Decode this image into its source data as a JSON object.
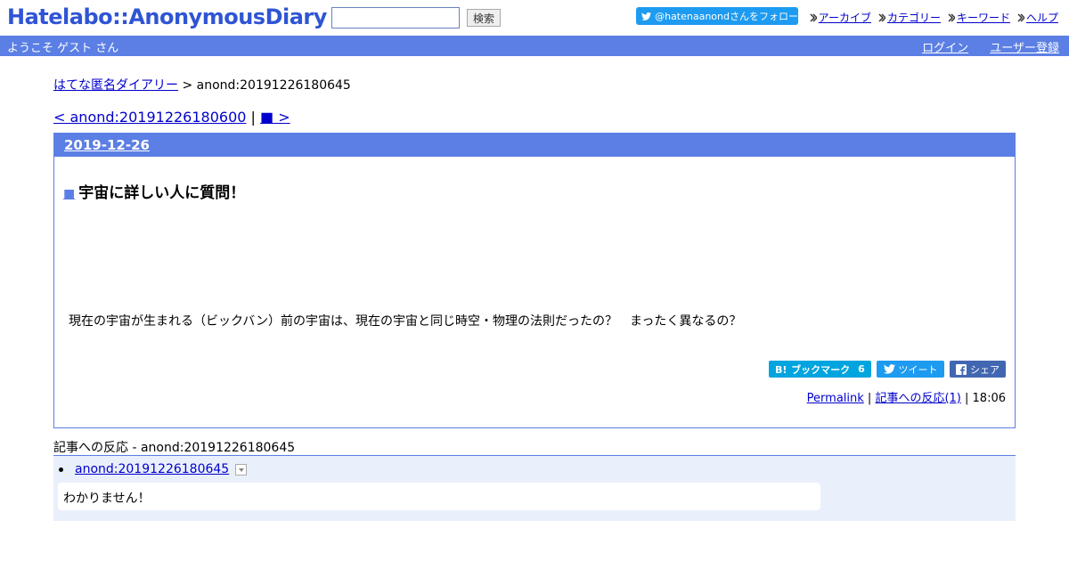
{
  "header": {
    "logo": "Hatelabo::AnonymousDiary",
    "search_placeholder": "",
    "search_button": "検索",
    "follow_button": "@hatenaanondさんをフォロー",
    "nav": [
      "アーカイブ",
      "カテゴリー",
      "キーワード",
      "ヘルプ"
    ]
  },
  "user_bar": {
    "welcome": "ようこそ ゲスト さん",
    "login": "ログイン",
    "register": "ユーザー登録"
  },
  "breadcrumb": {
    "home": "はてな匿名ダイアリー",
    "separator": " > ",
    "current": "anond:20191226180645"
  },
  "pager": {
    "prev": "< anond:20191226180600",
    "separator": " | ",
    "next": "■ >"
  },
  "day": {
    "date": "2019-12-26",
    "entry": {
      "anchor": "■",
      "title": "宇宙に詳しい人に質問！",
      "body": "現在の宇宙が生まれる（ビックバン）前の宇宙は、現在の宇宙と同じ時空・物理の法則だったの？　まったく異なるの？",
      "share": {
        "hatena": "ブックマーク",
        "hatena_count": "6",
        "tweet": "ツイート",
        "facebook": "シェア"
      },
      "footer": {
        "permalink": "Permalink",
        "sep1": " | ",
        "reactions_link": "記事への反応(1)",
        "sep2": " | ",
        "time": "18:06"
      }
    }
  },
  "reactions": {
    "title": "記事への反応 - anond:20191226180645",
    "items": [
      {
        "id": "anond:20191226180645",
        "text": "わかりません！"
      }
    ]
  },
  "colors": {
    "brand_blue": "#5b7fe4",
    "twitter": "#1d9bf0",
    "hatena": "#00a4de",
    "facebook": "#4267b2"
  }
}
